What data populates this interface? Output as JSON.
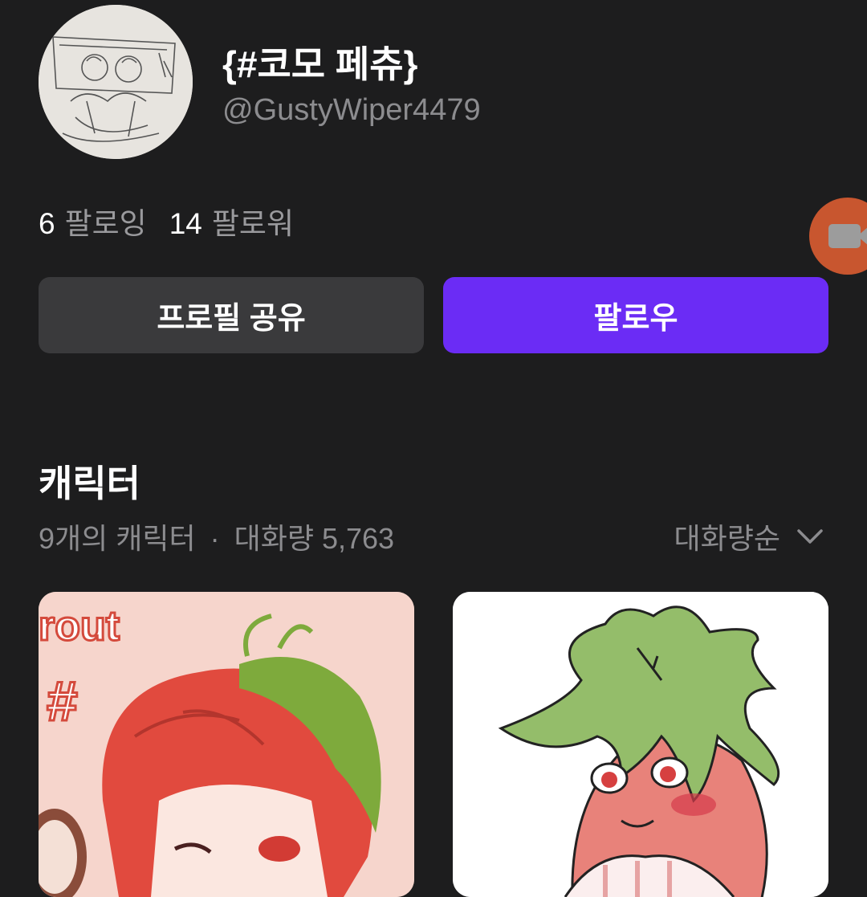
{
  "profile": {
    "name": "{#코모 페츄}",
    "handle": "@GustyWiper4479"
  },
  "stats": {
    "following_count": "6",
    "following_label": "팔로잉",
    "followers_count": "14",
    "followers_label": "팔로워"
  },
  "actions": {
    "share_label": "프로필 공유",
    "follow_label": "팔로우"
  },
  "characters": {
    "title": "캐릭터",
    "count_text": "9개의 캐릭터",
    "separator": "·",
    "conversation_text": "대화량 5,763",
    "sort_label": "대화량순"
  },
  "cards": [
    {
      "art_text": "rout"
    },
    {}
  ],
  "colors": {
    "background": "#1d1d1e",
    "follow_button": "#6b2cf5",
    "share_button": "#3a3a3c",
    "record_button": "#c8562f"
  }
}
